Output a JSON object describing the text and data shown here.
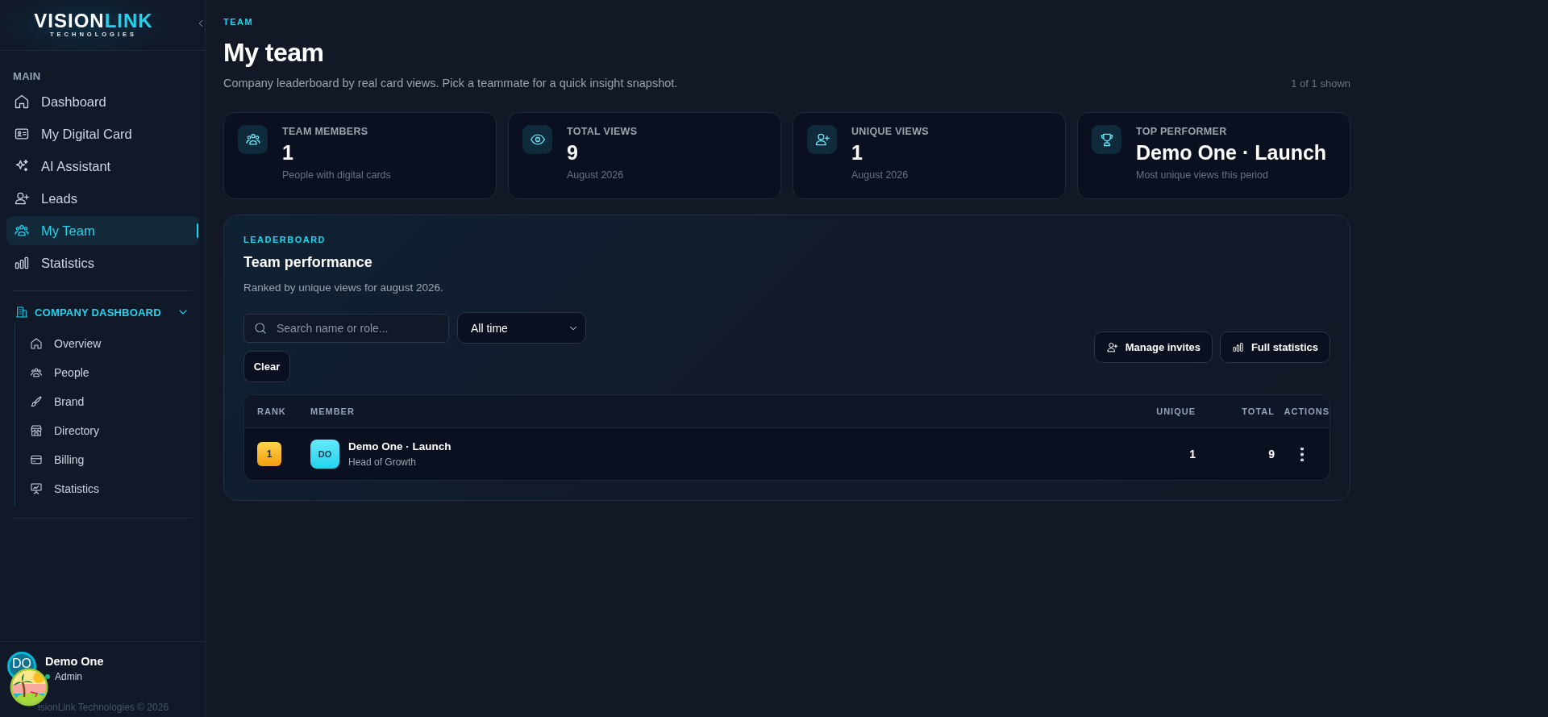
{
  "brand": {
    "name_part_1": "VISION",
    "name_part_2": "LINK",
    "tagline": "TECHNOLOGIES"
  },
  "sidebar": {
    "section_title": "MAIN",
    "items": [
      {
        "label": "Dashboard",
        "selected": false
      },
      {
        "label": "My Digital Card",
        "selected": false
      },
      {
        "label": "AI Assistant",
        "selected": false
      },
      {
        "label": "Leads",
        "selected": false
      },
      {
        "label": "My Team",
        "selected": true
      },
      {
        "label": "Statistics",
        "selected": false
      }
    ],
    "company": {
      "title": "COMPANY DASHBOARD",
      "expanded": true,
      "items": [
        {
          "label": "Overview",
          "selected": false
        },
        {
          "label": "People",
          "selected": false
        },
        {
          "label": "Brand",
          "selected": false
        },
        {
          "label": "Directory",
          "selected": false
        },
        {
          "label": "Billing",
          "selected": false
        },
        {
          "label": "Statistics",
          "selected": false
        }
      ]
    }
  },
  "user": {
    "initials": "DO",
    "name": "Demo One",
    "role": "Admin",
    "online": true
  },
  "footer": "isionLink Technologies © 2026",
  "page": {
    "eyebrow": "TEAM",
    "title": "My team",
    "subtitle": "Company leaderboard by real card views. Pick a teammate for a quick insight snapshot.",
    "count": "1 of 1 shown"
  },
  "stats": [
    {
      "label": "TEAM MEMBERS",
      "value": "1",
      "note": "People with digital cards"
    },
    {
      "label": "TOTAL VIEWS",
      "value": "9",
      "note": "August 2026"
    },
    {
      "label": "UNIQUE VIEWS",
      "value": "1",
      "note": "August 2026"
    },
    {
      "label": "TOP PERFORMER",
      "value": "Demo One · Launch",
      "note": "Most unique views this period"
    }
  ],
  "leaderboard": {
    "eyebrow": "LEADERBOARD",
    "title": "Team performance",
    "subtitle": "Ranked by unique views for august 2026.",
    "search": {
      "placeholder": "Search name or role..."
    },
    "period": {
      "value": "All time"
    },
    "clear": "Clear",
    "actions": [
      "Manage invites",
      "Full statistics"
    ],
    "table": {
      "columns": [
        "RANK",
        "MEMBER",
        "UNIQUE",
        "TOTAL",
        "ACTIONS"
      ],
      "rows": [
        {
          "rank": "1",
          "initials": "DO",
          "name": "Demo One · Launch",
          "role": "Head of Growth",
          "unique": "1",
          "total": "9"
        }
      ]
    }
  }
}
